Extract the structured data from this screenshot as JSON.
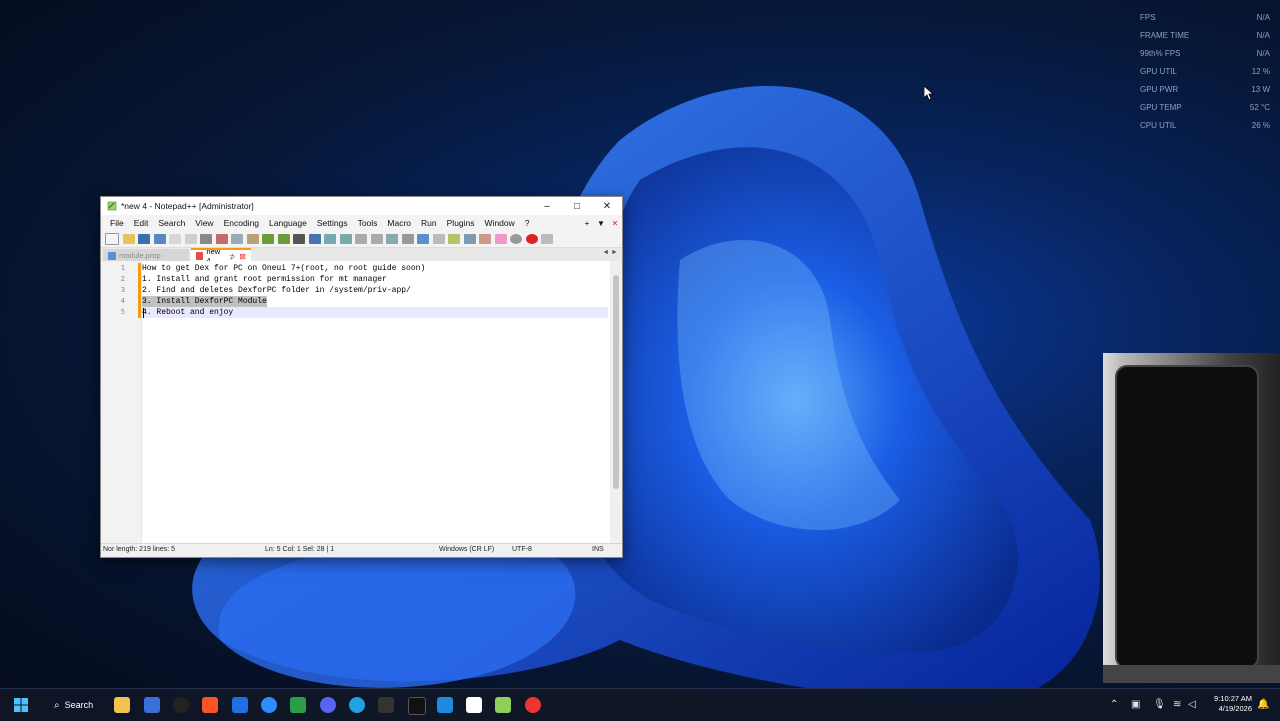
{
  "overlay": {
    "rows": [
      {
        "label": "FPS",
        "value": "N/A"
      },
      {
        "label": "FRAME TIME",
        "value": "N/A"
      },
      {
        "label": "99th% FPS",
        "value": "N/A"
      },
      {
        "label": "GPU UTIL",
        "value": "12 %"
      },
      {
        "label": "GPU PWR",
        "value": "13 W"
      },
      {
        "label": "GPU TEMP",
        "value": "52 °C"
      },
      {
        "label": "CPU UTIL",
        "value": "26 %"
      }
    ]
  },
  "window": {
    "title": "*new 4 - Notepad++ [Administrator]",
    "controls": {
      "minimize": "–",
      "maximize": "□",
      "close": "✕"
    }
  },
  "menu": {
    "items": [
      "File",
      "Edit",
      "Search",
      "View",
      "Encoding",
      "Language",
      "Settings",
      "Tools",
      "Macro",
      "Run",
      "Plugins",
      "Window",
      "?"
    ],
    "right": [
      "+",
      "▼",
      "✕"
    ]
  },
  "tabs": [
    {
      "label": "module.prop",
      "active": false
    },
    {
      "label": "new 4",
      "active": true
    }
  ],
  "tab_arrows": "◄ ►",
  "editor": {
    "lines": [
      {
        "num": "1",
        "text": "How to get Dex for PC on Oneui 7+(root, no root guide soon)"
      },
      {
        "num": "2",
        "text": "1. Install and grant root permission for mt manager"
      },
      {
        "num": "3",
        "text": "2. Find and deletes DexforPC folder in /system/priv-app/"
      },
      {
        "num": "4",
        "text": "3. Install DexforPC Module"
      },
      {
        "num": "5",
        "text": "4. Reboot and enjoy"
      }
    ]
  },
  "status": {
    "length": "Nor length: 219   lines: 5",
    "position": "Ln: 5   Col: 1   Sel: 28 | 1",
    "eol": "Windows (CR LF)",
    "encoding": "UTF-8",
    "mode": "INS"
  },
  "taskbar": {
    "search_label": "Search",
    "clock_time": "9:10:27 AM",
    "clock_date": "4/19/2026"
  },
  "colors": {
    "accent": "#f39c12",
    "taskbar": "#101626"
  }
}
